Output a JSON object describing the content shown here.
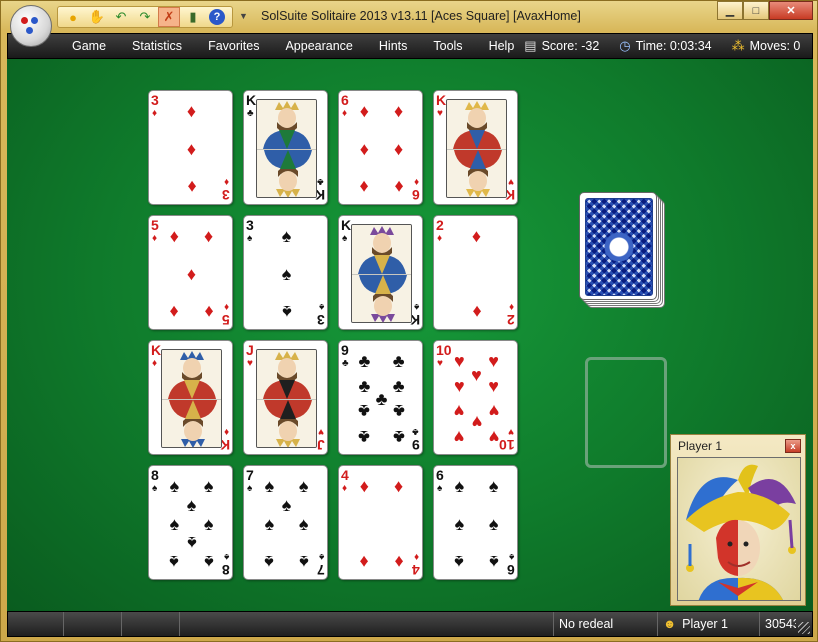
{
  "titlebar": {
    "title": "SolSuite Solitaire 2013 v13.11  [Aces Square]  [AvaxHome]",
    "quick_access": [
      "new-game-icon",
      "restart-icon",
      "undo-icon",
      "redo-icon",
      "hint-icon",
      "statistics-icon",
      "help-icon"
    ],
    "controls": {
      "minimize": "▁",
      "maximize": "□",
      "close": "✕"
    }
  },
  "menu": [
    "Game",
    "Statistics",
    "Favorites",
    "Appearance",
    "Hints",
    "Tools",
    "Help"
  ],
  "stats": {
    "score_label": "Score:",
    "score_value": "-32",
    "time_label": "Time:",
    "time_value": "0:03:34",
    "moves_label": "Moves:",
    "moves_value": "0"
  },
  "cards": [
    {
      "rank": "3",
      "suit": "♦",
      "color": "#d21c1c",
      "face": false
    },
    {
      "rank": "K",
      "suit": "♣",
      "color": "#111111",
      "face": true
    },
    {
      "rank": "6",
      "suit": "♦",
      "color": "#d21c1c",
      "face": false
    },
    {
      "rank": "K",
      "suit": "♥",
      "color": "#d21c1c",
      "face": true
    },
    {
      "rank": "5",
      "suit": "♦",
      "color": "#d21c1c",
      "face": false
    },
    {
      "rank": "3",
      "suit": "♠",
      "color": "#111111",
      "face": false
    },
    {
      "rank": "K",
      "suit": "♠",
      "color": "#111111",
      "face": true
    },
    {
      "rank": "2",
      "suit": "♦",
      "color": "#d21c1c",
      "face": false
    },
    {
      "rank": "K",
      "suit": "♦",
      "color": "#d21c1c",
      "face": true
    },
    {
      "rank": "J",
      "suit": "♥",
      "color": "#d21c1c",
      "face": true
    },
    {
      "rank": "9",
      "suit": "♣",
      "color": "#111111",
      "face": false
    },
    {
      "rank": "10",
      "suit": "♥",
      "color": "#d21c1c",
      "face": false
    },
    {
      "rank": "8",
      "suit": "♠",
      "color": "#111111",
      "face": false
    },
    {
      "rank": "7",
      "suit": "♠",
      "color": "#111111",
      "face": false
    },
    {
      "rank": "4",
      "suit": "♦",
      "color": "#d21c1c",
      "face": false
    },
    {
      "rank": "6",
      "suit": "♠",
      "color": "#111111",
      "face": false
    }
  ],
  "player": {
    "title": "Player 1",
    "close": "x"
  },
  "statusbar": {
    "redeal": "No redeal",
    "player": "Player 1",
    "number": "30543"
  },
  "colors": {
    "felt": "#0f7a2b",
    "frame": "#d8b85a",
    "menubar": "#2a2a2a"
  }
}
